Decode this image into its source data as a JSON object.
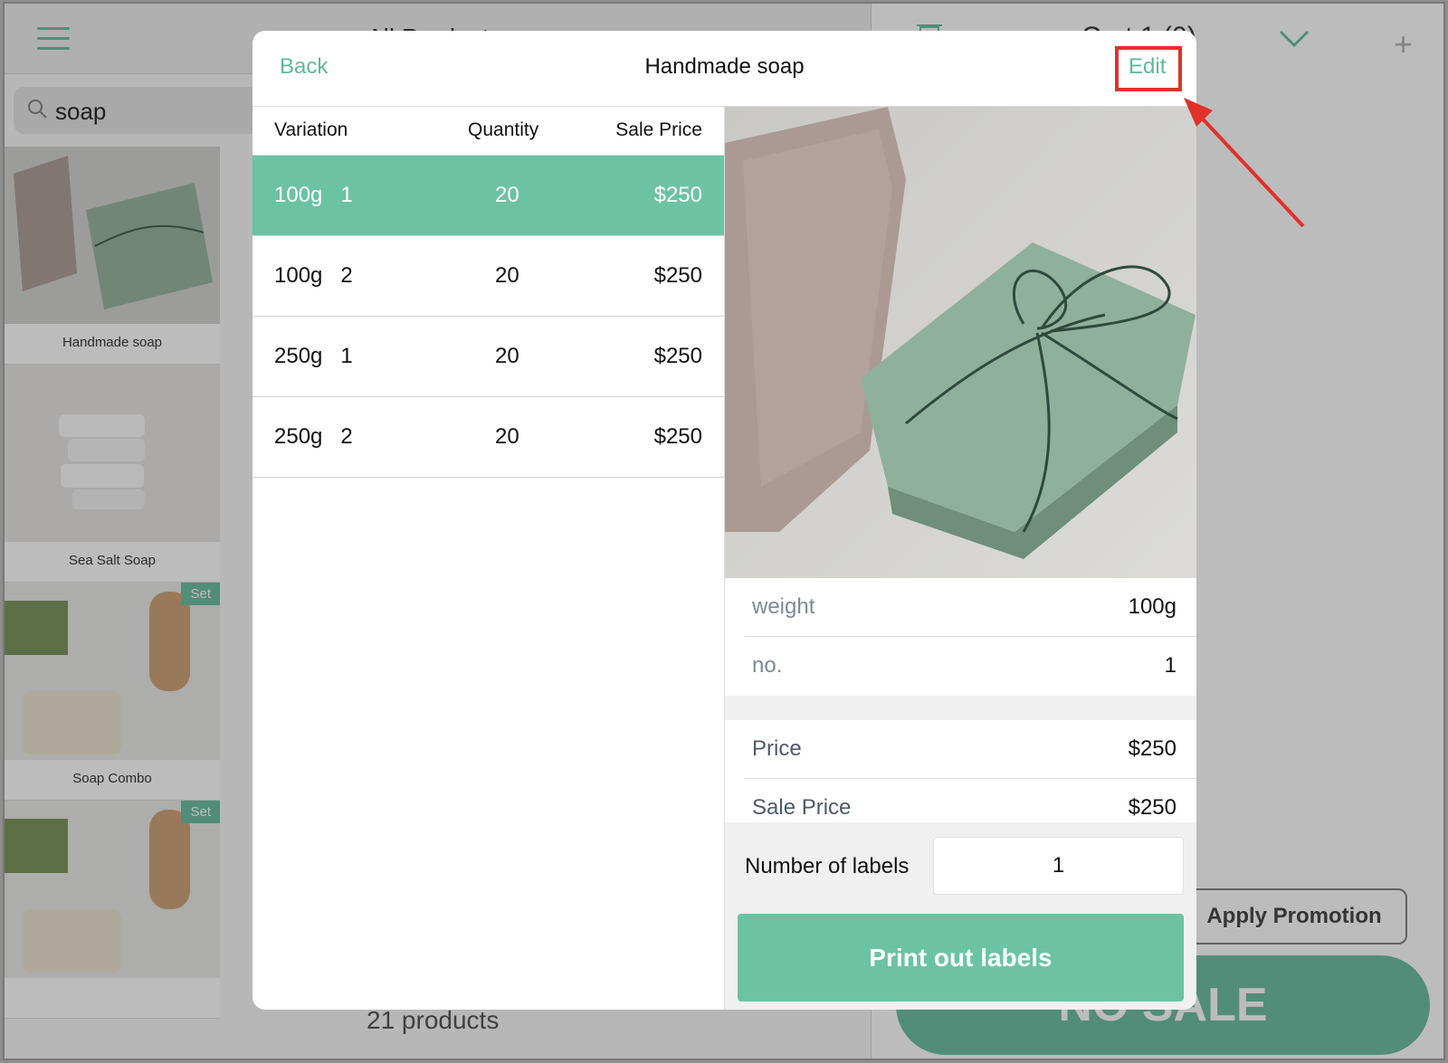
{
  "background": {
    "top_title": "All Products",
    "search": {
      "value": "soap"
    },
    "products": [
      {
        "name": "Handmade soap",
        "badge": ""
      },
      {
        "name": "Sea Salt Soap",
        "badge": ""
      },
      {
        "name": "Soap Combo",
        "badge": "Set"
      },
      {
        "name": "",
        "badge": "Set"
      }
    ],
    "products_count": "21 products",
    "cart_title": "Cart 1 (0)",
    "apply_promotion": "Apply Promotion",
    "no_sale": "NO SALE"
  },
  "modal": {
    "back_label": "Back",
    "title": "Handmade soap",
    "edit_label": "Edit",
    "table": {
      "headers": [
        "Variation",
        "Quantity",
        "Sale Price"
      ],
      "rows": [
        {
          "variation": "100g   1",
          "quantity": "20",
          "sale_price": "$250",
          "selected": true
        },
        {
          "variation": "100g   2",
          "quantity": "20",
          "sale_price": "$250",
          "selected": false
        },
        {
          "variation": "250g   1",
          "quantity": "20",
          "sale_price": "$250",
          "selected": false
        },
        {
          "variation": "250g   2",
          "quantity": "20",
          "sale_price": "$250",
          "selected": false
        }
      ]
    },
    "attributes": [
      {
        "key": "weight",
        "value": "100g"
      },
      {
        "key": "no.",
        "value": "1"
      }
    ],
    "prices": [
      {
        "key": "Price",
        "value": "$250"
      },
      {
        "key": "Sale Price",
        "value": "$250"
      }
    ],
    "labels": {
      "label": "Number of labels",
      "value": "1"
    },
    "print_button": "Print out labels"
  },
  "colors": {
    "accent": "#6bc3a4",
    "highlight_annotation": "#e0322a"
  }
}
